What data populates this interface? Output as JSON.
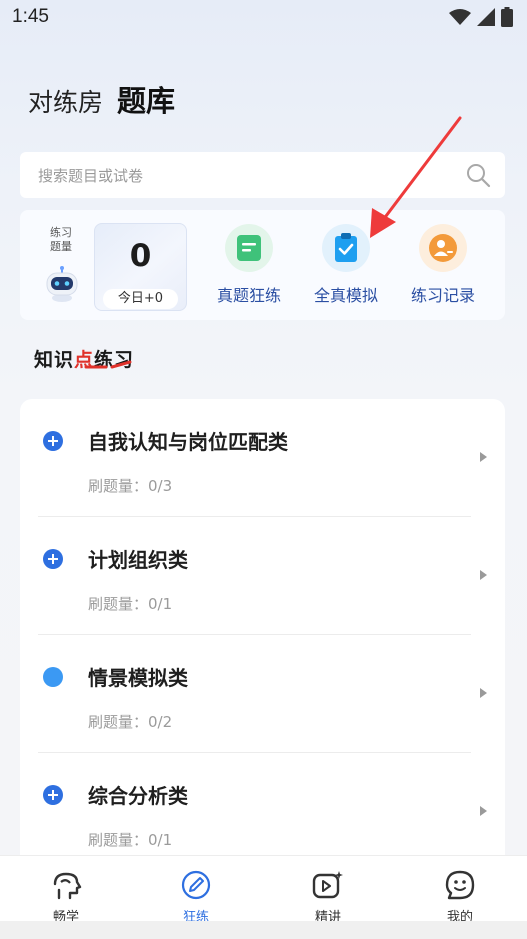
{
  "status": {
    "time": "1:45"
  },
  "header": {
    "brand": "对练房",
    "title": "题库"
  },
  "search": {
    "placeholder": "搜索题目或试卷"
  },
  "quick": {
    "practice_label": "练习题量",
    "count": "0",
    "today": "今日+0",
    "actions": [
      {
        "label": "真题狂练",
        "icon": "document-icon",
        "color": "#3fc27a"
      },
      {
        "label": "全真模拟",
        "icon": "clipboard-check-icon",
        "color": "#1e9ff0"
      },
      {
        "label": "练习记录",
        "icon": "person-record-icon",
        "color": "#f39a3a"
      }
    ]
  },
  "section": {
    "title_a": "知识",
    "title_b": "点",
    "title_c": "练习"
  },
  "topics": [
    {
      "name": "自我认知与岗位匹配类",
      "count": "刷题量：0/3",
      "icon": "plus-circle"
    },
    {
      "name": "计划组织类",
      "count": "刷题量：0/1",
      "icon": "plus-circle"
    },
    {
      "name": "情景模拟类",
      "count": "刷题量：0/2",
      "icon": "dot"
    },
    {
      "name": "综合分析类",
      "count": "刷题量：0/1",
      "icon": "plus-circle"
    }
  ],
  "tabs": [
    {
      "label": "畅学",
      "icon": "brain-icon"
    },
    {
      "label": "狂练",
      "icon": "pen-icon",
      "active": true
    },
    {
      "label": "精讲",
      "icon": "video-icon"
    },
    {
      "label": "我的",
      "icon": "smile-icon"
    }
  ],
  "colors": {
    "accent": "#2e6fe0",
    "label_blue": "#2b4fa3",
    "highlight_red": "#e0322b"
  }
}
